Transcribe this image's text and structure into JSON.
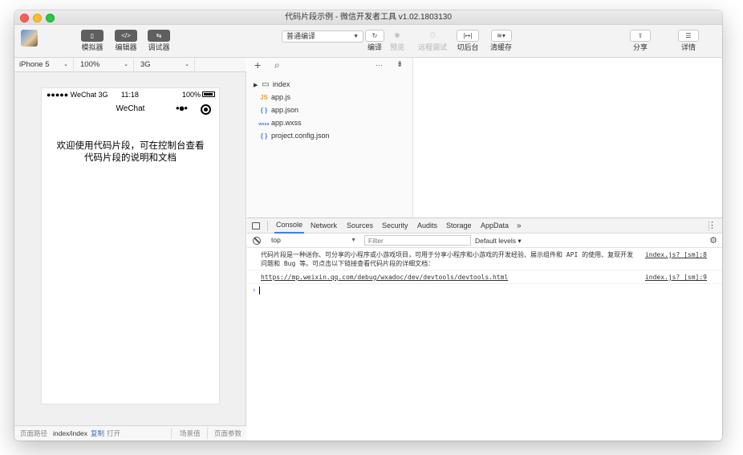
{
  "window": {
    "title": "代码片段示例 - 微信开发者工具 v1.02.1803130"
  },
  "toolbar": {
    "simulator_label": "模拟器",
    "editor_label": "编辑器",
    "debugger_label": "调试器",
    "compile_mode": "普通编译",
    "compile_label": "编译",
    "preview_label": "预览",
    "remote_debug_label": "远程调试",
    "background_label": "切后台",
    "clear_cache_label": "清缓存",
    "share_label": "分享",
    "details_label": "详情"
  },
  "device": {
    "model": "iPhone 5",
    "zoom": "100%",
    "network": "3G"
  },
  "phone": {
    "carrier": "●●●●● WeChat 3G",
    "time": "11:18",
    "battery": "100%",
    "nav_title": "WeChat",
    "nav_dots": "•●•",
    "welcome_line1": "欢迎使用代码片段，可在控制台查看",
    "welcome_line2": "代码片段的说明和文档"
  },
  "pathbar": {
    "label": "页面路径",
    "path": "index/index",
    "copy": "复制",
    "open": "打开",
    "scene": "场景值",
    "params": "页面参数"
  },
  "filetree": {
    "add_icon": "+",
    "search_icon": "⌕",
    "more": "···",
    "items": [
      {
        "name": "index",
        "icon": "folder-icon"
      },
      {
        "name": "app.js",
        "icon": "js-file-icon",
        "badge": "JS"
      },
      {
        "name": "app.json",
        "icon": "json-file-icon",
        "badge": "{ }"
      },
      {
        "name": "app.wxss",
        "icon": "wxss-file-icon",
        "badge": "wxss"
      },
      {
        "name": "project.config.json",
        "icon": "json-file-icon",
        "badge": "{ }"
      }
    ]
  },
  "devtools": {
    "tabs": [
      "Console",
      "Network",
      "Sources",
      "Security",
      "Audits",
      "Storage",
      "AppData"
    ],
    "overflow": "»",
    "context": "top",
    "filter_placeholder": "Filter",
    "levels": "Default levels ▾",
    "messages": [
      {
        "text": "代码片段是一种迷你、可分享的小程序或小游戏项目，可用于分享小程序和小游戏的开发经验、展示组件和 API 的使用、复现开发问题和 Bug 等。可点击以下链接查看代码片段的详细文档：",
        "source": "index.js? [sm]:8"
      },
      {
        "text": "https://mp.weixin.qq.com/debug/wxadoc/dev/devtools/devtools.html",
        "source": "index.js? [sm]:9"
      }
    ],
    "prompt": "›"
  }
}
